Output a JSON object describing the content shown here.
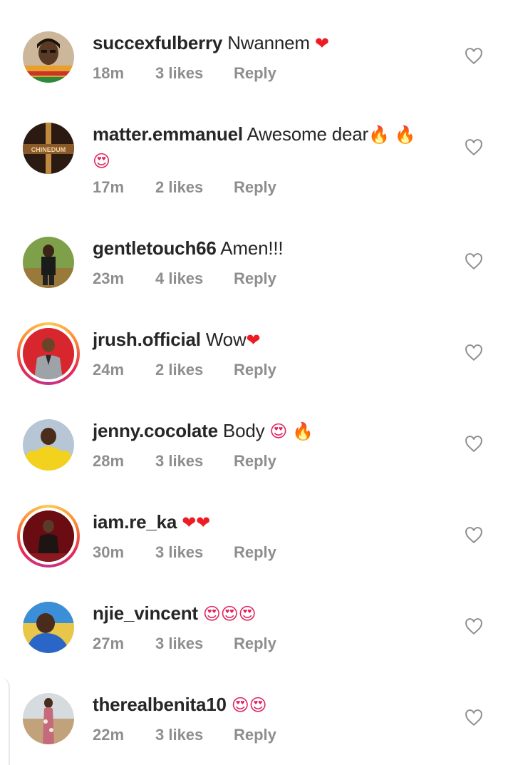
{
  "comments": [
    {
      "username": "succexfulberry",
      "text": "Nwannem",
      "emoji": "❤",
      "emoji2": "",
      "emoji3": "",
      "emoji_line2": "",
      "time": "18m",
      "likes": "3 likes",
      "reply": "Reply"
    },
    {
      "username": "matter.emmanuel",
      "text": "Awesome dear",
      "emoji": "🔥",
      "emoji2": "🔥",
      "emoji3": "",
      "emoji_line2": "😍",
      "time": "17m",
      "likes": "2 likes",
      "reply": "Reply"
    },
    {
      "username": "gentletouch66",
      "text": "Amen!!!",
      "emoji": "",
      "emoji2": "",
      "emoji3": "",
      "emoji_line2": "",
      "time": "23m",
      "likes": "4 likes",
      "reply": "Reply"
    },
    {
      "username": "jrush.official",
      "text": "Wow",
      "emoji": "❤",
      "emoji2": "",
      "emoji3": "",
      "emoji_line2": "",
      "time": "24m",
      "likes": "2 likes",
      "reply": "Reply"
    },
    {
      "username": "jenny.cocolate",
      "text": "Body",
      "emoji": "😍",
      "emoji2": "🔥",
      "emoji3": "",
      "emoji_line2": "",
      "time": "28m",
      "likes": "3 likes",
      "reply": "Reply"
    },
    {
      "username": "iam.re_ka",
      "text": "",
      "emoji": "❤",
      "emoji2": "❤",
      "emoji3": "",
      "emoji_line2": "",
      "time": "30m",
      "likes": "3 likes",
      "reply": "Reply"
    },
    {
      "username": "njie_vincent",
      "text": "",
      "emoji": "😍",
      "emoji2": "😍",
      "emoji3": "😍",
      "emoji_line2": "",
      "time": "27m",
      "likes": "3 likes",
      "reply": "Reply"
    },
    {
      "username": "therealbenita10",
      "text": "",
      "emoji": "😍",
      "emoji2": "😍",
      "emoji3": "",
      "emoji_line2": "",
      "time": "22m",
      "likes": "3 likes",
      "reply": "Reply"
    }
  ],
  "avatar_text": {
    "c1": "CHINEDUM"
  },
  "colors": {
    "text": "#262626",
    "meta": "#8e8e8e",
    "heart": "#ed1c24",
    "icon_outline": "#8e8e8e"
  },
  "icons": {
    "like": "heart-outline-icon"
  }
}
